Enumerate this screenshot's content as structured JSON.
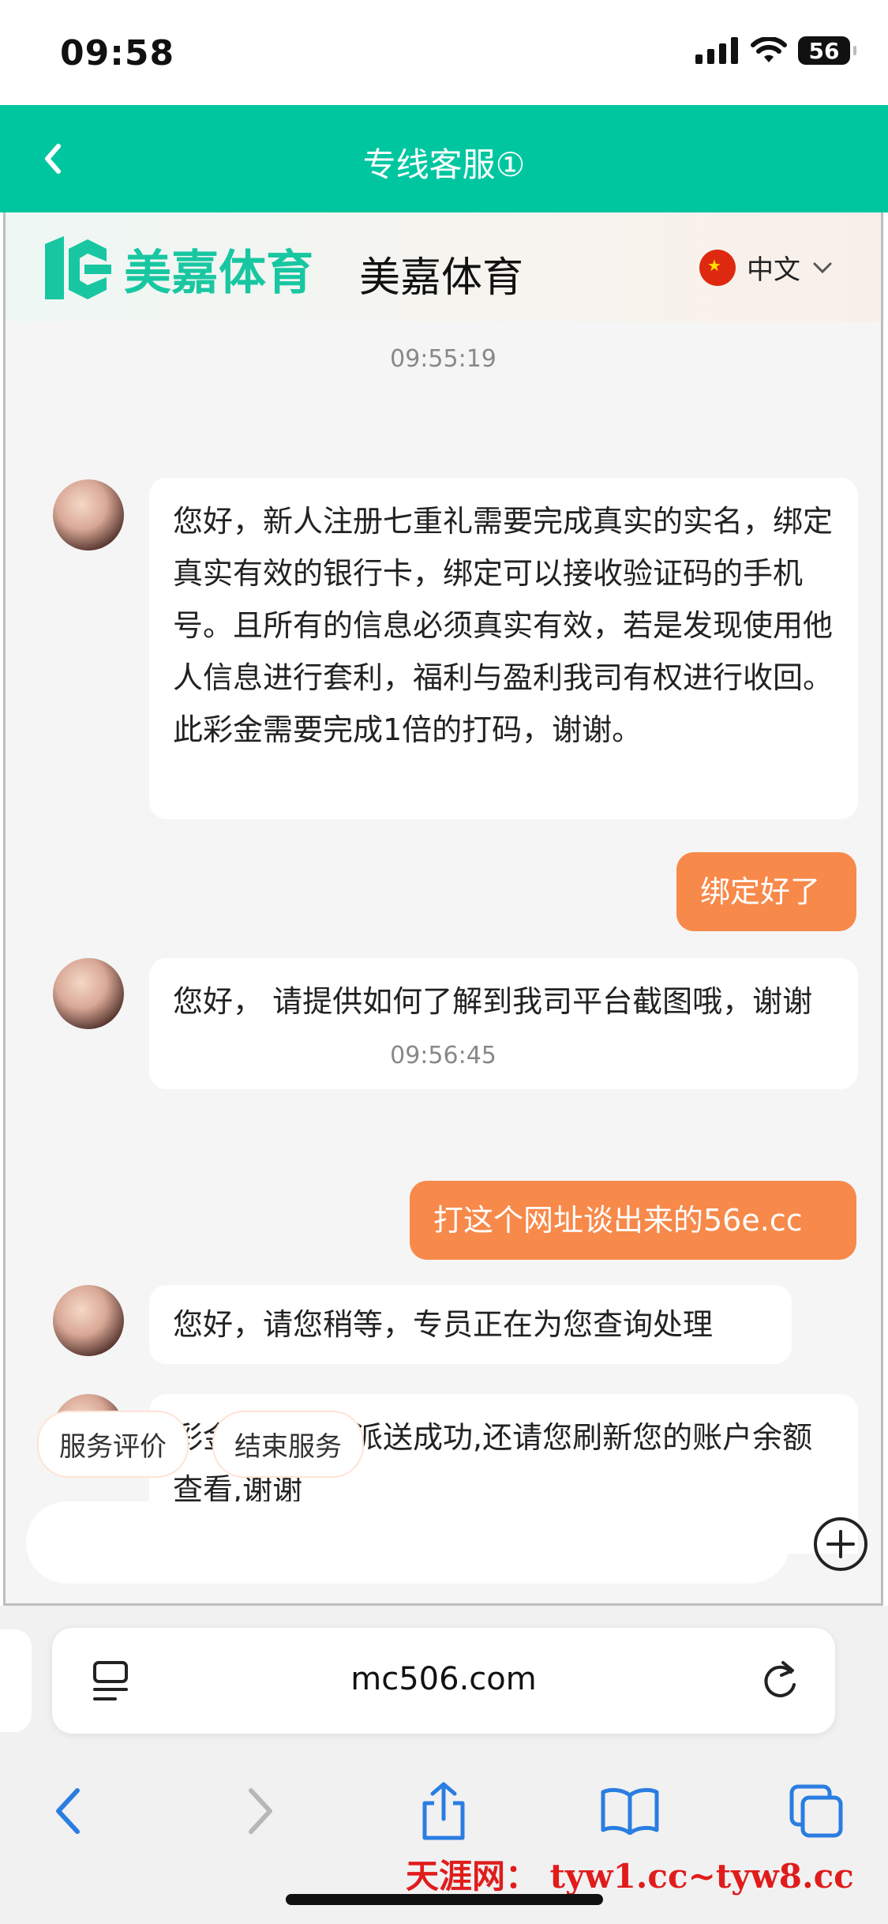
{
  "status_bar": {
    "time": "09:58",
    "battery": "56"
  },
  "header": {
    "title": "专线客服①"
  },
  "brand": {
    "logo_text": "美嘉体育",
    "name": "美嘉体育",
    "language": "中文"
  },
  "chat": {
    "timestamps": [
      "09:55:19",
      "09:56:45"
    ],
    "messages": [
      {
        "from": "agent",
        "text": "您好，新人注册七重礼需要完成真实的实名，绑定真实有效的银行卡，绑定可以接收验证码的手机号。且所有的信息必须真实有效，若是发现使用他人信息进行套利，福利与盈利我司有权进行收回。此彩金需要完成1倍的打码，谢谢。"
      },
      {
        "from": "user",
        "text": "绑定好了"
      },
      {
        "from": "agent",
        "text": "您好， 请提供如何了解到我司平台截图哦，谢谢"
      },
      {
        "from": "user",
        "text": "打这个网址谈出来的56e.cc"
      },
      {
        "from": "agent",
        "text": "您好，请您稍等，专员正在为您查询处理"
      },
      {
        "from": "agent",
        "text": "彩金已经为您派送成功,还请您刷新您的账户余额查看,谢谢"
      }
    ]
  },
  "quick_actions": [
    "服务评价",
    "结束服务"
  ],
  "input": {
    "placeholder": ""
  },
  "browser": {
    "url": "mc506.com"
  },
  "watermark": "天涯网： tyw1.cc~tyw8.cc"
}
